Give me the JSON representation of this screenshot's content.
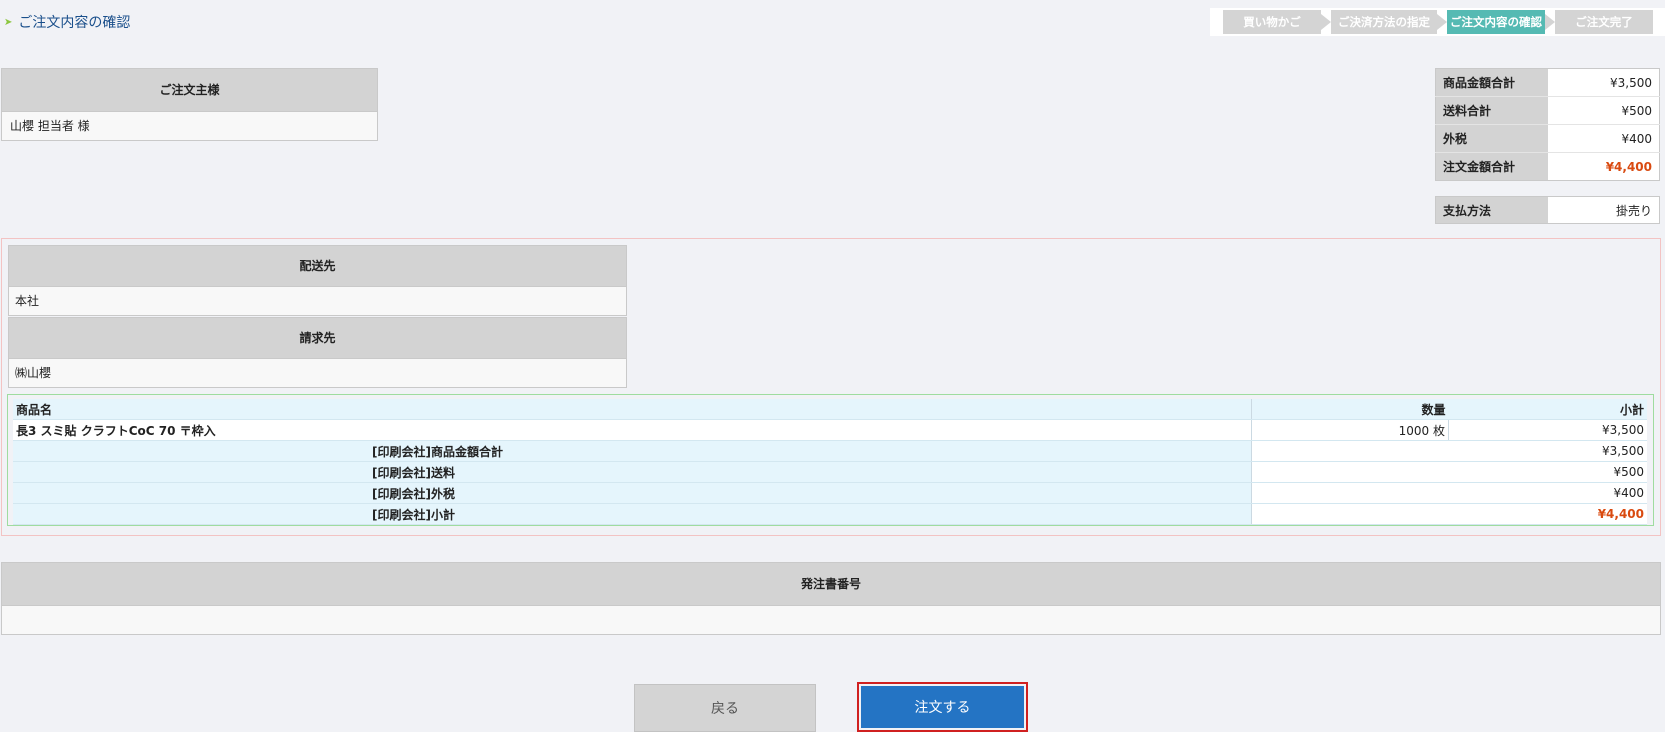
{
  "page": {
    "title": "ご注文内容の確認"
  },
  "steps": [
    "買い物かご",
    "ご決済方法の指定",
    "ご注文内容の確認",
    "ご注文完了"
  ],
  "orderer": {
    "header": "ご注文主様",
    "name": "山櫻 担当者 様"
  },
  "summary": {
    "rows": [
      {
        "label": "商品金額合計",
        "value": "¥3,500"
      },
      {
        "label": "送料合計",
        "value": "¥500"
      },
      {
        "label": "外税",
        "value": "¥400"
      },
      {
        "label": "注文金額合計",
        "value": "¥4,400"
      }
    ]
  },
  "payment": {
    "label": "支払方法",
    "value": "掛売り"
  },
  "shipping": {
    "header": "配送先",
    "value": "本社"
  },
  "billing": {
    "header": "請求先",
    "value": "㈱山櫻"
  },
  "items": {
    "headers": {
      "name": "商品名",
      "qty": "数量",
      "subtotal": "小計"
    },
    "rows": [
      {
        "name": "長3 スミ貼 クラフトCoC 70 〒枠入",
        "qty": "1000 枚",
        "subtotal": "¥3,500"
      }
    ],
    "totals": [
      {
        "label": "[印刷会社]商品金額合計",
        "value": "¥3,500"
      },
      {
        "label": "[印刷会社]送料",
        "value": "¥500"
      },
      {
        "label": "[印刷会社]外税",
        "value": "¥400"
      },
      {
        "label": "[印刷会社]小計",
        "value": "¥4,400"
      }
    ]
  },
  "po_number": {
    "header": "発注書番号",
    "value": ""
  },
  "buttons": {
    "back": "戻る",
    "order": "注文する"
  },
  "colors": {
    "accent_red": "#d94a10",
    "step_active": "#55bab3",
    "primary_button": "#2474c4"
  }
}
